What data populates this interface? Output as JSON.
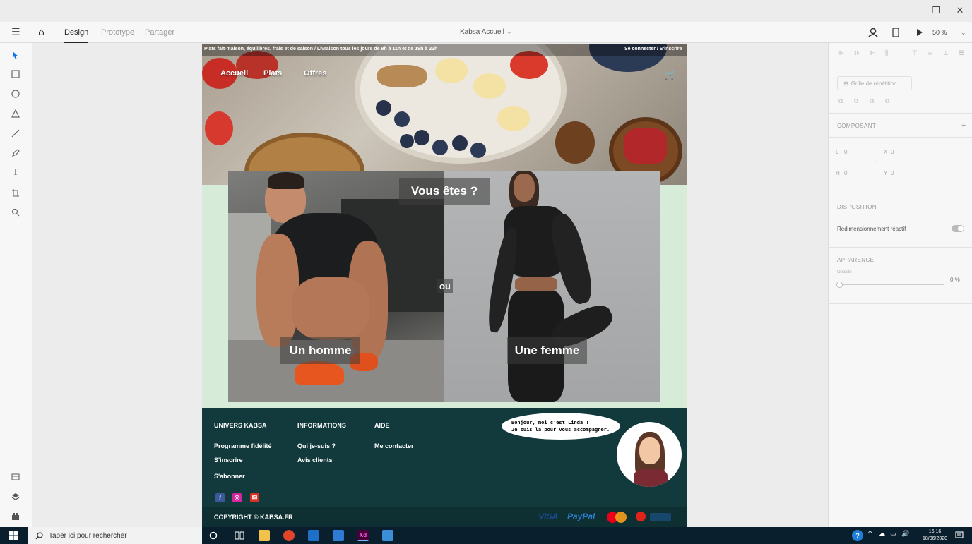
{
  "window": {
    "minimize": "–",
    "maximize": "❐",
    "close": "✕"
  },
  "toolbar": {
    "menu_icon": "☰",
    "home_icon": "⌂",
    "tabs": [
      "Design",
      "Prototype",
      "Partager"
    ],
    "document_title": "Kabsa Accueil",
    "zoom": "50 %",
    "chevron": "⌄"
  },
  "artboard": {
    "topbar_left": "Plats fait-maison, équilibrés, frais et de saison / Livraison tous les jours de 9h à 11h et de 19h à 22h",
    "topbar_right": "Se connecter / S'inscrire",
    "nav": [
      "Accueil",
      "Plats",
      "Offres"
    ],
    "cart_icon": "🛒",
    "question": "Vous êtes ?",
    "or": "ou",
    "man": "Un homme",
    "woman": "Une femme",
    "footer": {
      "col1_head": "UNIVERS KABSA",
      "col1_links": [
        "Programme fidélité",
        "S'inscrire",
        "S'abonner"
      ],
      "col2_head": "INFORMATIONS",
      "col2_links": [
        "Qui je-suis ?",
        "Avis clients"
      ],
      "col3_head": "AIDE",
      "col3_links": [
        "Me contacter"
      ],
      "bubble_line1": "Bonjour, moi c'est Linda !",
      "bubble_line2": "Je suis la pour vous accompagner.",
      "social": [
        "f",
        "◎",
        "✉"
      ],
      "copyright": "COPYRIGHT © KABSA.FR",
      "payments": [
        "VISA",
        "PayPal"
      ]
    }
  },
  "right_panel": {
    "repeat_grid": "Grille de répétition",
    "component": "COMPOSANT",
    "w_label": "L",
    "w_value": "0",
    "h_label": "H",
    "h_value": "0",
    "x_label": "X",
    "x_value": "0",
    "y_label": "Y",
    "y_value": "0",
    "disposition": "DISPOSITION",
    "responsive": "Redimensionnement réactif",
    "appearance": "APPARENCE",
    "opacity_label": "Opacité",
    "opacity_value": "0 %"
  },
  "taskbar": {
    "search_placeholder": "Taper ici pour rechercher",
    "time": "16:16",
    "date": "18/06/2020",
    "xd": "Xd"
  }
}
